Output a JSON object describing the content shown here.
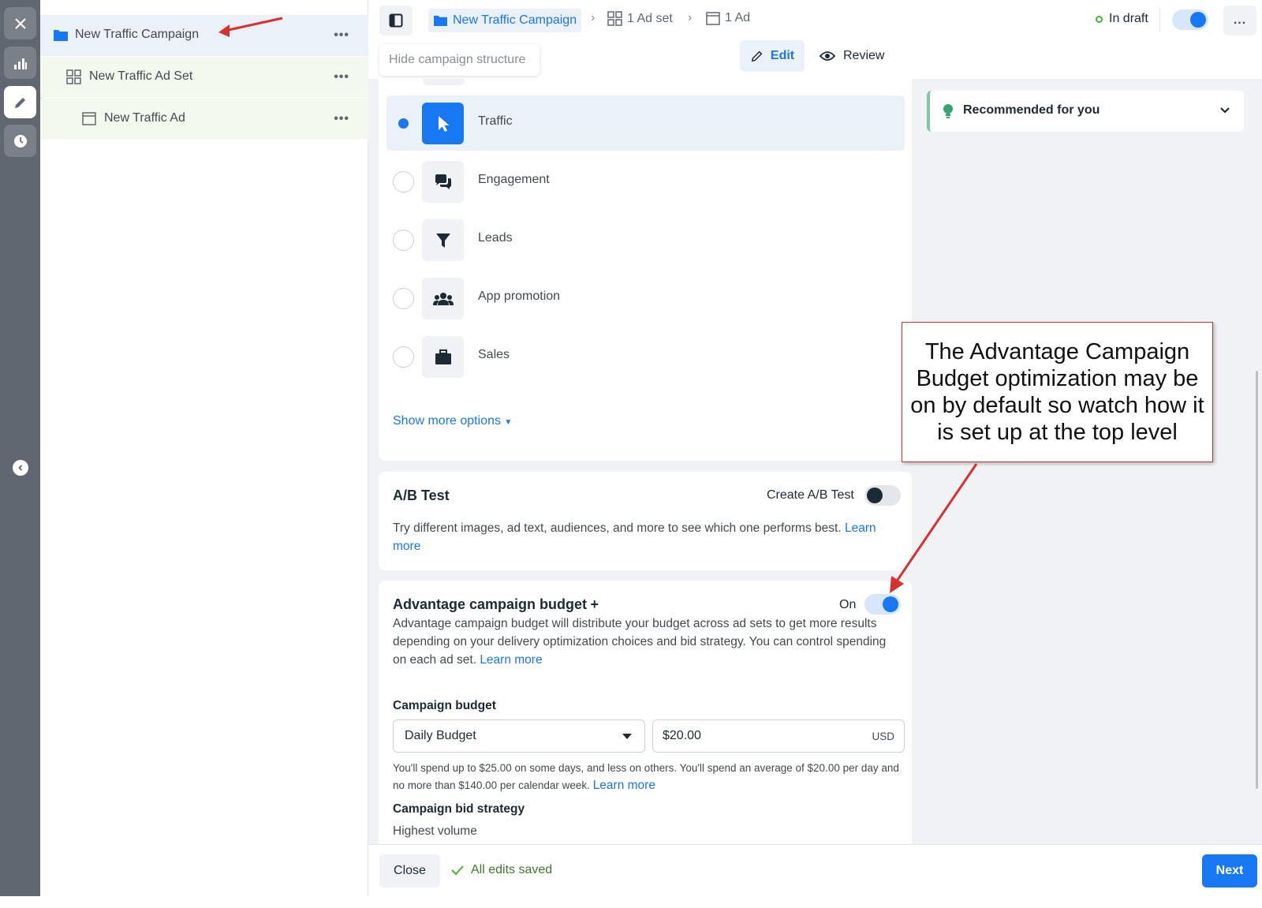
{
  "tree": {
    "campaign": "New Traffic Campaign",
    "adset": "New Traffic Ad Set",
    "ad": "New Traffic Ad"
  },
  "topbar": {
    "crumb_campaign": "New Traffic Campaign",
    "crumb_adset": "1 Ad set",
    "crumb_ad": "1 Ad",
    "status": "In draft",
    "more": "..."
  },
  "toolbar": {
    "hide_structure_tooltip": "Hide campaign structure",
    "edit_label": "Edit",
    "review_label": "Review"
  },
  "objectives": {
    "items": [
      {
        "label": "Traffic",
        "selected": true,
        "icon": "cursor-icon"
      },
      {
        "label": "Engagement",
        "selected": false,
        "icon": "chat-bubbles-icon"
      },
      {
        "label": "Leads",
        "selected": false,
        "icon": "funnel-icon"
      },
      {
        "label": "App promotion",
        "selected": false,
        "icon": "people-icon"
      },
      {
        "label": "Sales",
        "selected": false,
        "icon": "briefcase-icon"
      }
    ],
    "show_more": "Show more options"
  },
  "ab_test": {
    "title": "A/B Test",
    "toggle_label": "Create A/B Test",
    "description": "Try different images, ad text, audiences, and more to see which one performs best.",
    "learn_more_1": "Learn",
    "learn_more_2": "more"
  },
  "advantage": {
    "title": "Advantage campaign budget",
    "plus": "+",
    "toggle_label": "On",
    "description": "Advantage campaign budget will distribute your budget across ad sets to get more results depending on your delivery optimization choices and bid strategy. You can control spending on each ad set.",
    "learn_more": "Learn more"
  },
  "budget": {
    "title": "Campaign budget",
    "type": "Daily Budget",
    "amount": "$20.00",
    "currency": "USD",
    "note": "You'll spend up to $25.00 on some days, and less on others. You'll spend an average of $20.00 per day and no more than $140.00 per calendar week.",
    "learn_more": "Learn more"
  },
  "bid": {
    "title": "Campaign bid strategy",
    "value": "Highest volume"
  },
  "recommended": {
    "label": "Recommended for you"
  },
  "annotation": {
    "text": "The Advantage Campaign Budget optimization may be on by default so watch how it is set up at the top level"
  },
  "footer": {
    "close": "Close",
    "saved": "All edits saved",
    "next": "Next"
  },
  "colors": {
    "accent": "#1877f2",
    "annotation_red": "#d9312e",
    "success": "#42b72a"
  }
}
